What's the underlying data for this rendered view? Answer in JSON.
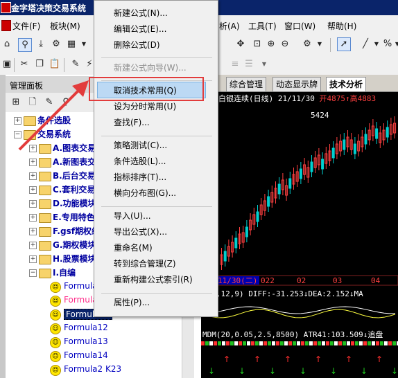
{
  "title_bar": {
    "title": "金字塔决策交易系统"
  },
  "menubar": {
    "items_left": [
      "文件(F)",
      "板块(M)"
    ],
    "items_right": [
      "析(A)",
      "工具(T)",
      "窗口(W)",
      "帮助(H)"
    ]
  },
  "panel": {
    "title": "管理面板",
    "tree": [
      {
        "label": "条件选股",
        "type": "folder",
        "level": 0
      },
      {
        "label": "交易系统",
        "type": "folder",
        "level": 0,
        "expanded": true
      },
      {
        "label": "A.图表交易",
        "type": "folder",
        "level": 1
      },
      {
        "label": "A.新图表交",
        "type": "folder",
        "level": 1
      },
      {
        "label": "B.后台交易",
        "type": "folder",
        "level": 1
      },
      {
        "label": "C.套利交易",
        "type": "folder",
        "level": 1
      },
      {
        "label": "D.功能模块",
        "type": "folder",
        "level": 1
      },
      {
        "label": "E.专用特色",
        "type": "folder",
        "level": 1
      },
      {
        "label": "F.gsf期权组",
        "type": "folder",
        "level": 1
      },
      {
        "label": "G.期权模块",
        "type": "folder",
        "level": 1
      },
      {
        "label": "H.股票模块",
        "type": "folder",
        "level": 1
      },
      {
        "label": "I.自编",
        "type": "folder",
        "level": 1,
        "expanded": true
      },
      {
        "label": "Formula",
        "type": "formula",
        "level": 2
      },
      {
        "label": "Formula",
        "type": "formula",
        "level": 2,
        "color": "#ff2d8a"
      },
      {
        "label": "Formula11",
        "type": "formula",
        "level": 2,
        "selected": true
      },
      {
        "label": "Formula12",
        "type": "formula",
        "level": 2
      },
      {
        "label": "Formula13",
        "type": "formula",
        "level": 2
      },
      {
        "label": "Formula14",
        "type": "formula",
        "level": 2
      },
      {
        "label": "Formula2 K23",
        "type": "formula",
        "level": 2
      }
    ]
  },
  "context_menu": {
    "items": [
      {
        "label": "新建公式(N)...",
        "enabled": true
      },
      {
        "label": "编辑公式(E)...",
        "enabled": true
      },
      {
        "label": "删除公式(D)",
        "enabled": true
      },
      {
        "label": "新建公式向导(W)...",
        "enabled": false
      },
      {
        "label": "取消技术常用(Q)",
        "enabled": true,
        "highlighted": true
      },
      {
        "label": "设为分时常用(U)",
        "enabled": true
      },
      {
        "label": "查找(F)...",
        "enabled": true
      },
      {
        "label": "策略测试(C)...",
        "enabled": true
      },
      {
        "label": "条件选股(L)...",
        "enabled": true
      },
      {
        "label": "指标排序(T)...",
        "enabled": true
      },
      {
        "label": "横向分布图(G)...",
        "enabled": true
      },
      {
        "label": "导入(U)...",
        "enabled": true
      },
      {
        "label": "导出公式(X)...",
        "enabled": true
      },
      {
        "label": "重命名(M)",
        "enabled": true
      },
      {
        "label": "转到综合管理(Z)",
        "enabled": true
      },
      {
        "label": "重新构建公式索引(R)",
        "enabled": true
      },
      {
        "label": "属性(P)...",
        "enabled": true
      }
    ]
  },
  "chart": {
    "tabs": [
      "综合管理",
      "动态显示牌",
      "技术分析"
    ],
    "active_tab": "技术分析",
    "legend": "白银连续(日线) 21/11/30",
    "open_label": "开4875",
    "high_label": "↑高4883",
    "peak_label": "5424",
    "date_axis": [
      "11/30(二)",
      "022",
      "02",
      "03",
      "04"
    ],
    "macd_label": "(26,12,9) DIFF:-31.253↓DEA:2.152↓MA",
    "mdm_label": "MDM(20,0.05,2.5,8500) ATR41:103.509↓追盘",
    "colors": {
      "up": "#ff4040",
      "down": "#00d0d0",
      "background": "#000000",
      "accent": "#e23c3c",
      "highlight": "#bcd9f4"
    }
  }
}
